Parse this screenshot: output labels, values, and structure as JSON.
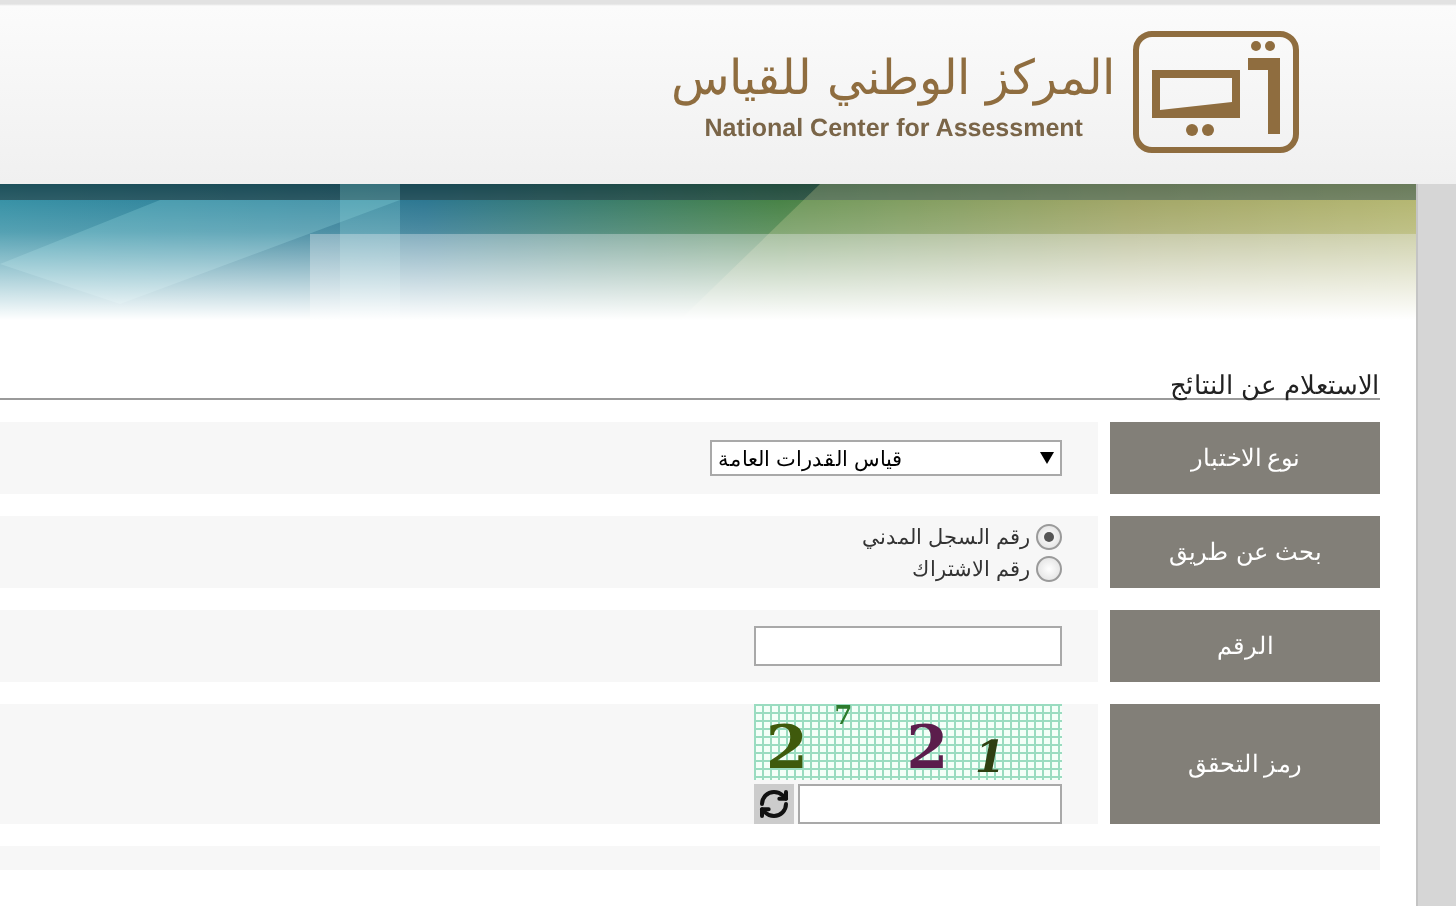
{
  "header": {
    "logo_arabic": "المركز الوطني للقياس",
    "logo_english": "National Center for Assessment"
  },
  "page_title": "الاستعلام عن النتائج",
  "form": {
    "rows": [
      {
        "kind": "select",
        "label": "نوع الاختبار",
        "value": "قياس القدرات العامة"
      },
      {
        "kind": "radio",
        "label": "بحث عن طريق",
        "options": [
          {
            "label": "رقم السجل المدني",
            "selected": true
          },
          {
            "label": "رقم الاشتراك",
            "selected": false
          }
        ]
      },
      {
        "kind": "text",
        "label": "الرقم"
      },
      {
        "kind": "captcha",
        "label": "رمز التحقق",
        "captcha_text": "2 7 2 1"
      }
    ]
  }
}
